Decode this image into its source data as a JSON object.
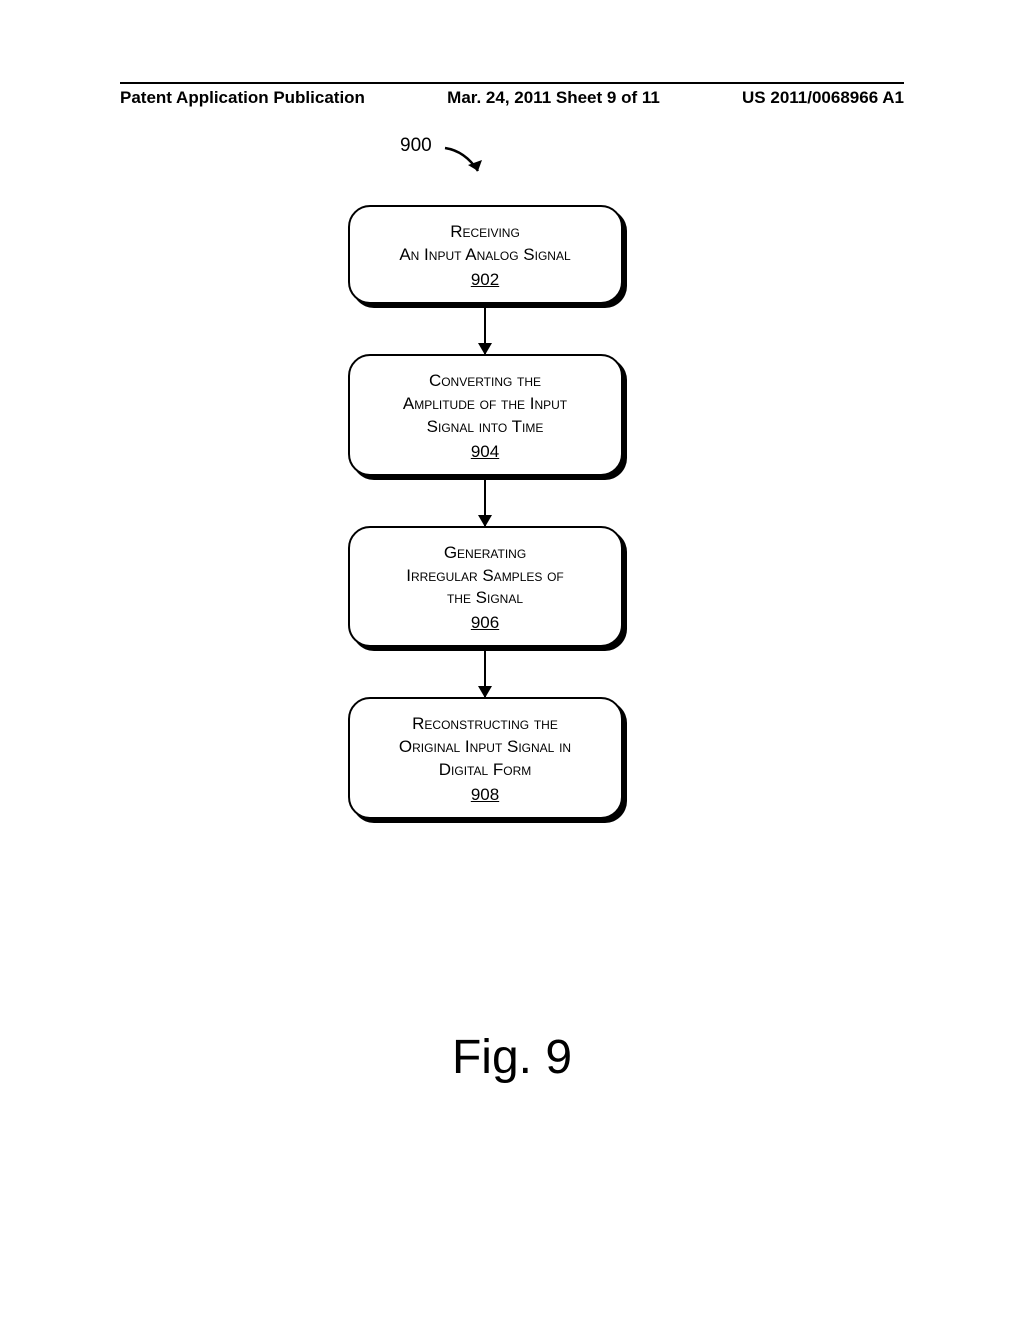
{
  "header": {
    "left": "Patent Application Publication",
    "center": "Mar. 24, 2011  Sheet 9 of 11",
    "right": "US 2011/0068966 A1"
  },
  "reference_label": "900",
  "boxes": [
    {
      "line1": "Receiving",
      "line2": "An Input Analog Signal",
      "ref": "902"
    },
    {
      "line1": "Converting the",
      "line2": "Amplitude of the Input",
      "line3": "Signal into Time",
      "ref": "904"
    },
    {
      "line1": "Generating",
      "line2": "Irregular Samples of",
      "line3": "the Signal",
      "ref": "906"
    },
    {
      "line1": "Reconstructing the",
      "line2": "Original Input Signal in",
      "line3": "Digital Form",
      "ref": "908"
    }
  ],
  "caption": "Fig. 9"
}
